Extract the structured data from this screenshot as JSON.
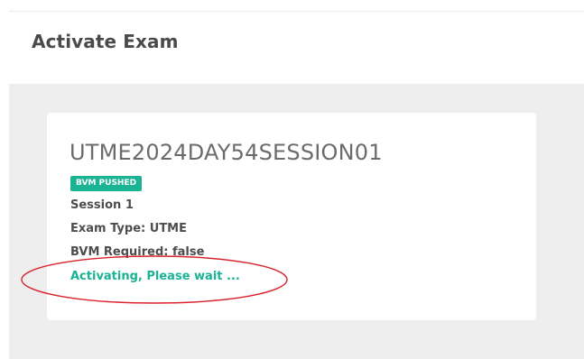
{
  "page": {
    "title": "Activate Exam"
  },
  "exam_card": {
    "exam_code": "UTME2024DAY54SESSION01",
    "badge": "BVM PUSHED",
    "session": "Session 1",
    "exam_type": "Exam Type: UTME",
    "bvm_required": "BVM Required: false",
    "status_message": "Activating, Please wait ..."
  },
  "colors": {
    "accent_green": "#1ab394",
    "annotation_red": "#d9232d",
    "content_background": "#eeeeee"
  },
  "annotation": {
    "shape": "ellipse",
    "highlights": "status_message"
  }
}
